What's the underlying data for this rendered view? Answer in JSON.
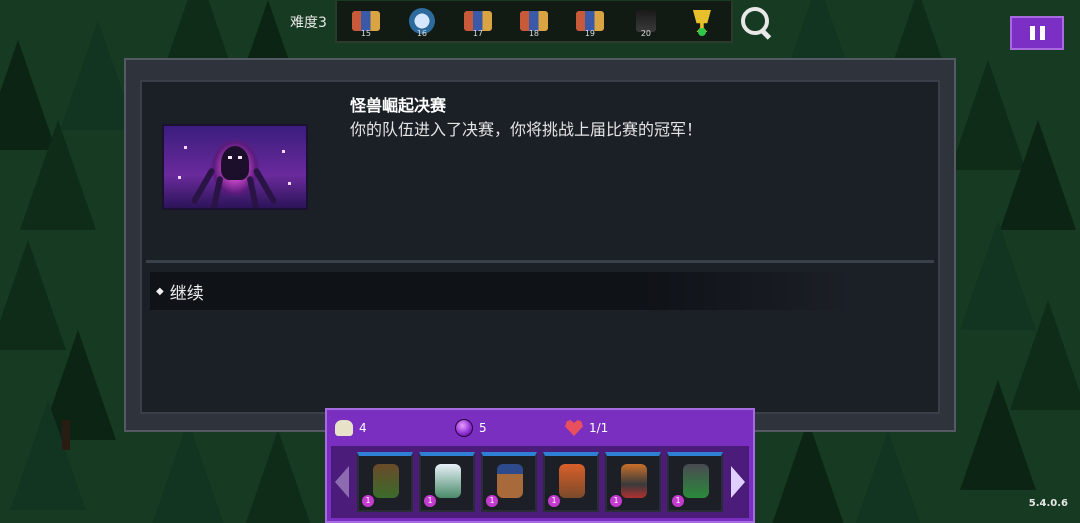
{
  "top_bar": {
    "difficulty_label": "难度3",
    "stages": [
      {
        "number": "15",
        "icon": "party-sprite-icon"
      },
      {
        "number": "16",
        "icon": "boss-sprite-icon"
      },
      {
        "number": "17",
        "icon": "party-sprite-icon"
      },
      {
        "number": "18",
        "icon": "party-sprite-icon"
      },
      {
        "number": "19",
        "icon": "party-sprite-icon"
      },
      {
        "number": "20",
        "icon": "dark-sprite-icon"
      }
    ],
    "final_stage_icon": "trophy-icon"
  },
  "search_icon": "search-icon",
  "pause_icon": "pause-icon",
  "event": {
    "title": "怪兽崛起决赛",
    "description": "你的队伍进入了决赛，你将挑战上届比赛的冠军！",
    "image": "tentacle-monster-portrait",
    "choices": [
      {
        "label": "继续"
      }
    ]
  },
  "party": {
    "bag_count": "4",
    "orb_count": "5",
    "health": "1/1",
    "icons": {
      "bag": "bag-icon",
      "orb": "orb-icon",
      "health": "heart-icon"
    },
    "heroes": [
      {
        "name": "tree-warrior-hero",
        "level": "1"
      },
      {
        "name": "frost-yeti-hero",
        "level": "1"
      },
      {
        "name": "ninja-bear-hero",
        "level": "1"
      },
      {
        "name": "fire-druid-hero",
        "level": "1"
      },
      {
        "name": "bandit-hero",
        "level": "1"
      },
      {
        "name": "dark-knight-hero",
        "level": "1"
      }
    ]
  },
  "version": "5.4.0.6",
  "colors": {
    "panel_purple": "#7a2fc0",
    "dialog_bg": "#1b1f26",
    "forest": "#173a22"
  }
}
